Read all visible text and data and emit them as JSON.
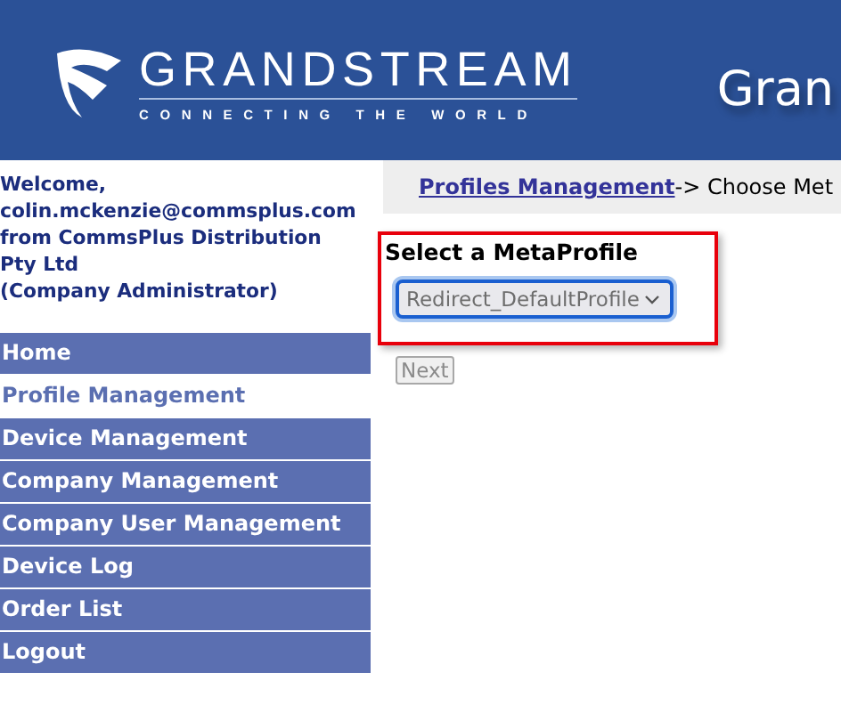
{
  "header": {
    "logo_name": "GRANDSTREAM",
    "logo_tagline": "CONNECTING THE WORLD",
    "title": "Gran"
  },
  "welcome": {
    "lines": [
      "Welcome,",
      "colin.mckenzie@commsplus.com",
      "from CommsPlus Distribution",
      "Pty Ltd",
      "(Company Administrator)"
    ]
  },
  "sidebar": {
    "items": [
      {
        "label": "Home",
        "selected": false
      },
      {
        "label": "Profile Management",
        "selected": true
      },
      {
        "label": "Device Management",
        "selected": false
      },
      {
        "label": "Company Management",
        "selected": false
      },
      {
        "label": "Company User Management",
        "selected": false
      },
      {
        "label": "Device Log",
        "selected": false
      },
      {
        "label": "Order List",
        "selected": false
      },
      {
        "label": "Logout",
        "selected": false
      }
    ]
  },
  "breadcrumb": {
    "link": "Profiles Management ",
    "rest": "-> Choose Met"
  },
  "form": {
    "label": "Select a MetaProfile",
    "select_value": "Redirect_DefaultProfile",
    "next_button": {
      "label": "Next",
      "disabled": true
    }
  }
}
